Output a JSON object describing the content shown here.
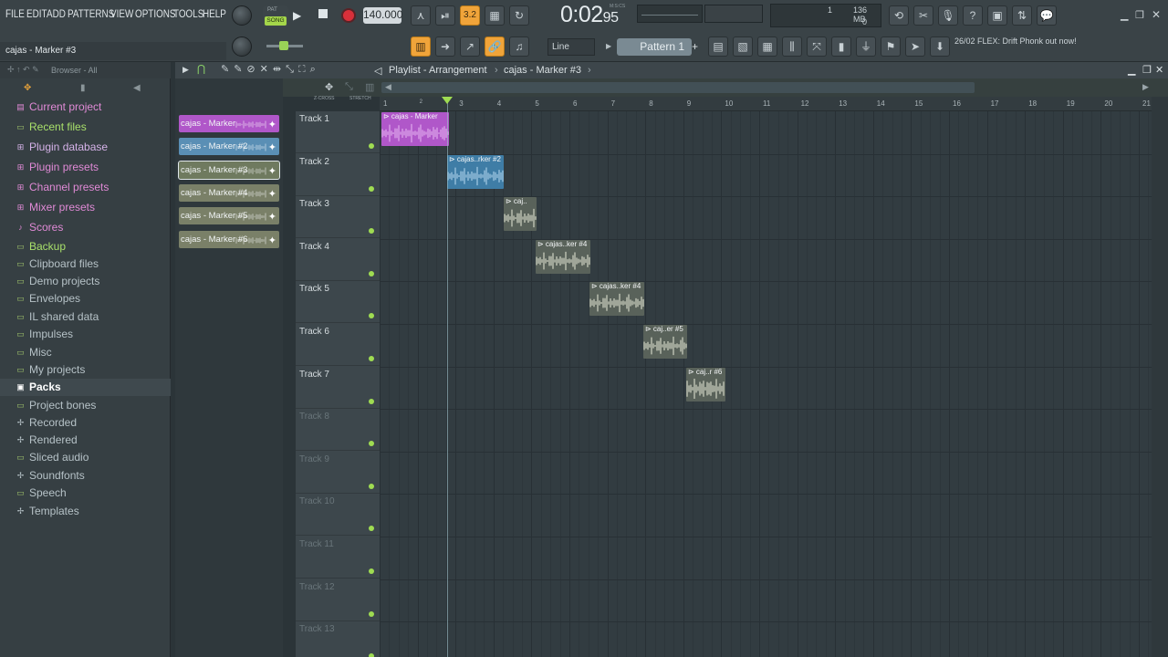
{
  "menu": {
    "items": [
      "FILE",
      "EDIT",
      "ADD",
      "PATTERNS",
      "VIEW",
      "OPTIONS",
      "TOOLS",
      "HELP"
    ]
  },
  "transport": {
    "pat_label": "PAT",
    "song_label": "SONG",
    "tempo": "140.000",
    "time_main": "0:02",
    "time_small": "95",
    "time_caption": "M:S:CS",
    "counter": "1",
    "memory": "136 MB",
    "memory2": "0"
  },
  "hint": {
    "text": "cajas - Marker #3"
  },
  "toolbar": {
    "snap": "Line",
    "pattern": "Pattern 1"
  },
  "news": {
    "text": "26/02  FLEX: Drift Phonk out now!"
  },
  "browser": {
    "header": "Browser - All",
    "items": [
      {
        "label": "Current project",
        "color": "#e08ad6",
        "icon": "project-icon"
      },
      {
        "label": "Recent files",
        "color": "#a8e06a",
        "icon": "folder-icon"
      },
      {
        "label": "Plugin database",
        "color": "#d5b2e8",
        "icon": "plug-icon"
      },
      {
        "label": "Plugin presets",
        "color": "#e08ad6",
        "icon": "plug-icon"
      },
      {
        "label": "Channel presets",
        "color": "#e08ad6",
        "icon": "plug-icon"
      },
      {
        "label": "Mixer presets",
        "color": "#e08ad6",
        "icon": "plug-icon"
      },
      {
        "label": "Scores",
        "color": "#e08ad6",
        "icon": "note-icon"
      },
      {
        "label": "Backup",
        "color": "#a8e06a",
        "icon": "folder-icon"
      },
      {
        "label": "Clipboard files",
        "color": "#b6c2c7",
        "icon": "folder-icon"
      },
      {
        "label": "Demo projects",
        "color": "#b6c2c7",
        "icon": "folder-icon"
      },
      {
        "label": "Envelopes",
        "color": "#b6c2c7",
        "icon": "folder-icon"
      },
      {
        "label": "IL shared data",
        "color": "#b6c2c7",
        "icon": "folder-icon"
      },
      {
        "label": "Impulses",
        "color": "#b6c2c7",
        "icon": "folder-icon"
      },
      {
        "label": "Misc",
        "color": "#b6c2c7",
        "icon": "folder-icon"
      },
      {
        "label": "My projects",
        "color": "#b6c2c7",
        "icon": "folder-icon"
      },
      {
        "label": "Packs",
        "color": "#ffffff",
        "icon": "packs-icon"
      },
      {
        "label": "Project bones",
        "color": "#b6c2c7",
        "icon": "folder-icon"
      },
      {
        "label": "Recorded",
        "color": "#b6c2c7",
        "icon": "plus-icon"
      },
      {
        "label": "Rendered",
        "color": "#b6c2c7",
        "icon": "plus-icon"
      },
      {
        "label": "Sliced audio",
        "color": "#b6c2c7",
        "icon": "folder-icon"
      },
      {
        "label": "Soundfonts",
        "color": "#b6c2c7",
        "icon": "plus-icon"
      },
      {
        "label": "Speech",
        "color": "#b6c2c7",
        "icon": "folder-icon"
      },
      {
        "label": "Templates",
        "color": "#b6c2c7",
        "icon": "plus-icon"
      }
    ]
  },
  "playlist": {
    "title": "Playlist - Arrangement",
    "crumb": "cajas - Marker #3",
    "zscroll_label": "Z-CROSS",
    "stretch_label": "STRETCH",
    "ruler": [
      "2",
      "3",
      "4",
      "5",
      "6",
      "7",
      "8",
      "9",
      "10",
      "11",
      "12",
      "13",
      "14",
      "15",
      "16",
      "17",
      "18",
      "19",
      "20",
      "21"
    ],
    "ruler_first": "1",
    "tracks": [
      "Track 1",
      "Track 2",
      "Track 3",
      "Track 4",
      "Track 5",
      "Track 6",
      "Track 7",
      "Track 8",
      "Track 9",
      "Track 10",
      "Track 11",
      "Track 12",
      "Track 13"
    ],
    "picker": [
      {
        "label": "cajas - Marker",
        "color": "#b057c9"
      },
      {
        "label": "cajas - Marker #2",
        "color": "#5a8fb5"
      },
      {
        "label": "cajas - Marker #3",
        "color": "#6f7a5f"
      },
      {
        "label": "cajas - Marker #4",
        "color": "#7a8068"
      },
      {
        "label": "cajas - Marker #5",
        "color": "#7a8068"
      },
      {
        "label": "cajas - Marker #6",
        "color": "#7a8068"
      }
    ],
    "clips": [
      {
        "label": "cajas - Marker",
        "color": "#b057c9",
        "wave": "#e8b8f2"
      },
      {
        "label": "cajas..rker #2",
        "color": "#3f7da6",
        "wave": "#b8dcf3"
      },
      {
        "label": "caj..",
        "color": "#59625a",
        "wave": "#e7ead8"
      },
      {
        "label": "cajas..ker #4",
        "color": "#59625a",
        "wave": "#e7ead8"
      },
      {
        "label": "cajas..ker #4",
        "color": "#59625a",
        "wave": "#e7ead8"
      },
      {
        "label": "caj..er #5",
        "color": "#59625a",
        "wave": "#e7ead8"
      },
      {
        "label": "caj..r #6",
        "color": "#59625a",
        "wave": "#e7ead8"
      }
    ]
  }
}
